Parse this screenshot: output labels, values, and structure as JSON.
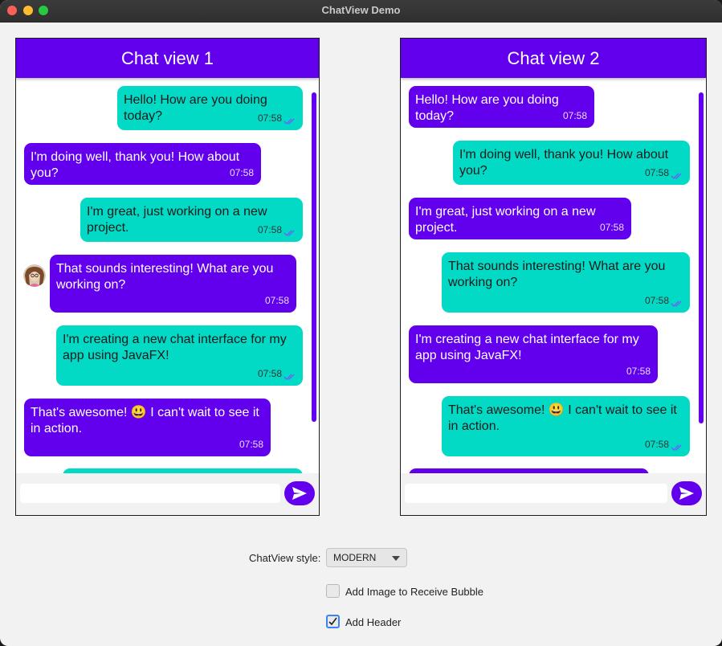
{
  "window": {
    "title": "ChatView Demo"
  },
  "chat1": {
    "header": "Chat view 1",
    "messages": [
      {
        "type": "sent",
        "text": "Hello! How are you doing today?",
        "time": "07:58"
      },
      {
        "type": "received",
        "text": "I'm doing well, thank you! How about you?",
        "time": "07:58"
      },
      {
        "type": "sent",
        "text": "I'm great, just working on a new project.",
        "time": "07:58"
      },
      {
        "type": "received",
        "text": "That sounds interesting! What are you working on?",
        "time": "07:58",
        "avatar": true
      },
      {
        "type": "sent",
        "text": "I'm creating a new chat interface for my app using JavaFX!",
        "time": "07:58"
      },
      {
        "type": "received",
        "text": "That's awesome! 😃 I can't wait to see it in action.",
        "time": "07:58"
      }
    ]
  },
  "chat2": {
    "header": "Chat view 2",
    "messages": [
      {
        "type": "received",
        "text": "Hello! How are you doing today?",
        "time": "07:58"
      },
      {
        "type": "sent",
        "text": "I'm doing well, thank you! How about you?",
        "time": "07:58"
      },
      {
        "type": "received",
        "text": "I'm great, just working on a new project.",
        "time": "07:58"
      },
      {
        "type": "sent",
        "text": "That sounds interesting! What are you working on?",
        "time": "07:58"
      },
      {
        "type": "received",
        "text": "I'm creating a new chat interface for my app using JavaFX!",
        "time": "07:58"
      },
      {
        "type": "sent",
        "text": "That's awesome! 😃 I can't wait to see it in action.",
        "time": "07:58"
      }
    ]
  },
  "controls": {
    "style_label": "ChatView style:",
    "style_value": "MODERN",
    "add_image_label": "Add Image to Receive Bubble",
    "add_image_checked": false,
    "add_header_label": "Add Header",
    "add_header_checked": true
  },
  "colors": {
    "accent": "#6200ee",
    "sent_bubble": "#03dac6",
    "tick": "#6b5cff"
  }
}
